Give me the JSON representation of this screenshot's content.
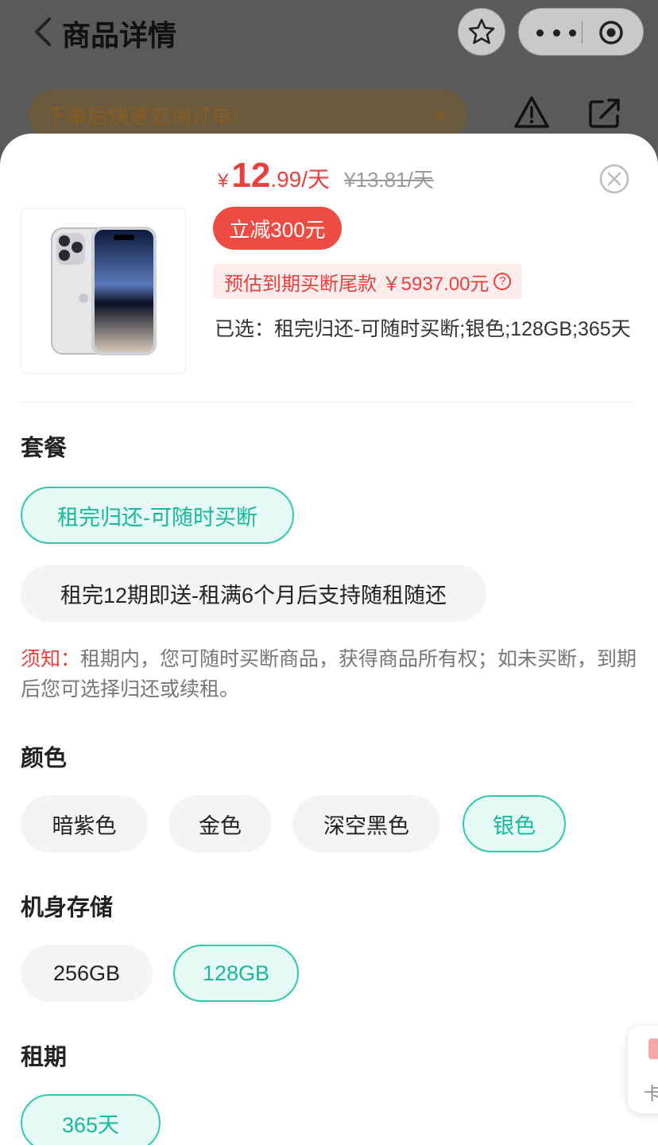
{
  "nav": {
    "title": "商品详情"
  },
  "notice": {
    "text": "下单后快速查询订单!",
    "close": "×"
  },
  "product": {
    "price_yen": "¥",
    "price_int": "12",
    "price_rest": ".99/天",
    "original_price": "¥13.81/天",
    "discount": "立减300元",
    "estimate": "预估到期买断尾款 ￥5937.00元",
    "selected": "已选：租完归还-可随时买断;银色;128GB;365天"
  },
  "plan": {
    "title": "套餐",
    "options": [
      "租完归还-可随时买断",
      "租完12期即送-租满6个月后支持随租随还"
    ],
    "note_label": "须知：",
    "note_text": "租期内，您可随时买断商品，获得商品所有权；如未买断，到期后您可选择归还或续租。"
  },
  "color": {
    "title": "颜色",
    "options": [
      "暗紫色",
      "金色",
      "深空黑色",
      "银色"
    ]
  },
  "storage": {
    "title": "机身存储",
    "options": [
      "256GB",
      "128GB"
    ]
  },
  "term": {
    "title": "租期",
    "options": [
      "365天"
    ]
  },
  "float_card": {
    "text": "卡"
  },
  "colors": {
    "accent": "#31c9ad",
    "price": "#e8403e"
  }
}
